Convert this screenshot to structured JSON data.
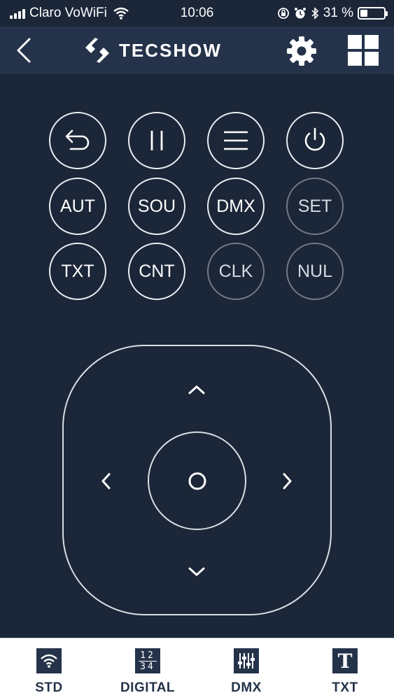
{
  "status_bar": {
    "carrier": "Claro VoWiFi",
    "time": "10:06",
    "battery_percent": "31 %",
    "battery_level": 0.31
  },
  "header": {
    "brand": "TECSHOW"
  },
  "buttons": {
    "row1": [
      "back",
      "pause",
      "menu",
      "power"
    ],
    "aut": "AUT",
    "sou": "SOU",
    "dmx": "DMX",
    "set": "SET",
    "txt": "TXT",
    "cnt": "CNT",
    "clk": "CLK",
    "nul": "NUL"
  },
  "tabs": [
    {
      "label": "STD",
      "icon": "wifi-icon"
    },
    {
      "label": "DIGITAL",
      "icon": "digits-icon",
      "digits": [
        "1",
        "2",
        "3",
        "4"
      ]
    },
    {
      "label": "DMX",
      "icon": "sliders-icon"
    },
    {
      "label": "TXT",
      "icon": "text-icon",
      "glyph": "T"
    }
  ],
  "colors": {
    "background": "#1b2638",
    "header": "#25334a",
    "button_border": "#e9edf2",
    "button_border_dim": "#6f7989",
    "tab_text": "#25334a"
  }
}
